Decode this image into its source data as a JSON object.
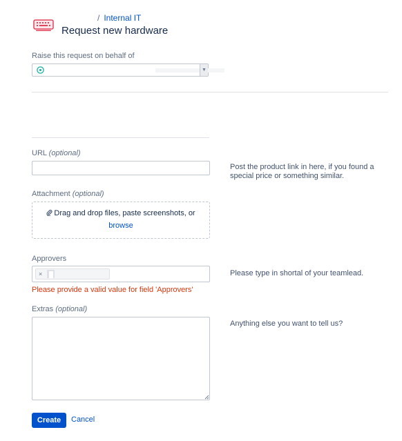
{
  "header": {
    "breadcrumb_separator": "/",
    "breadcrumb_link": "Internal IT",
    "title": "Request new hardware",
    "icon": "keyboard-icon"
  },
  "on_behalf": {
    "label": "Raise this request on behalf of",
    "value_icon": "user-circle-icon"
  },
  "url_field": {
    "label": "URL",
    "optional": "(optional)",
    "value": "",
    "help": "Post the product link in here, if you found a special price or something similar."
  },
  "attachment": {
    "label": "Attachment",
    "optional": "(optional)",
    "drop_text": "Drag and drop files, paste screenshots, or",
    "browse": "browse"
  },
  "approvers": {
    "label": "Approvers",
    "help": "Please type in shortal of your teamlead.",
    "chip_remove": "×",
    "error": "Please provide a valid value for field 'Approvers'"
  },
  "extras": {
    "label": "Extras",
    "optional": "(optional)",
    "help": "Anything else you want to tell us?"
  },
  "actions": {
    "create": "Create",
    "cancel": "Cancel"
  },
  "colors": {
    "primary": "#0052cc",
    "error": "#de350b",
    "icon_accent": "#e2445c",
    "avatar_accent": "#2bb5a6"
  }
}
